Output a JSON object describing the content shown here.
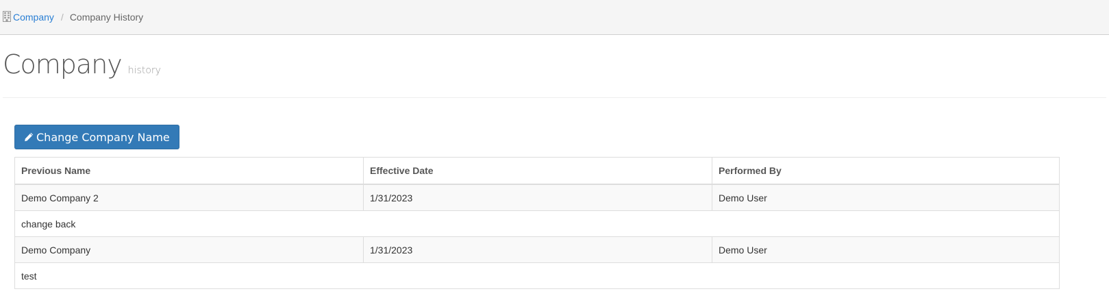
{
  "breadcrumb": {
    "root_label": "Company",
    "separator": "/",
    "current_label": "Company History"
  },
  "header": {
    "title": "Company",
    "subtitle": "history"
  },
  "actions": {
    "change_name_label": "Change Company Name"
  },
  "table": {
    "columns": [
      "Previous Name",
      "Effective Date",
      "Performed By"
    ],
    "rows": [
      {
        "previous_name": "Demo Company 2",
        "effective_date": "1/31/2023",
        "performed_by": "Demo User",
        "comment": "change back"
      },
      {
        "previous_name": "Demo Company",
        "effective_date": "1/31/2023",
        "performed_by": "Demo User",
        "comment": "test"
      }
    ]
  },
  "colors": {
    "primary": "#337ab7",
    "link": "#2a7fd4"
  },
  "icons": {
    "breadcrumb": "building-icon",
    "button": "pencil-icon"
  }
}
